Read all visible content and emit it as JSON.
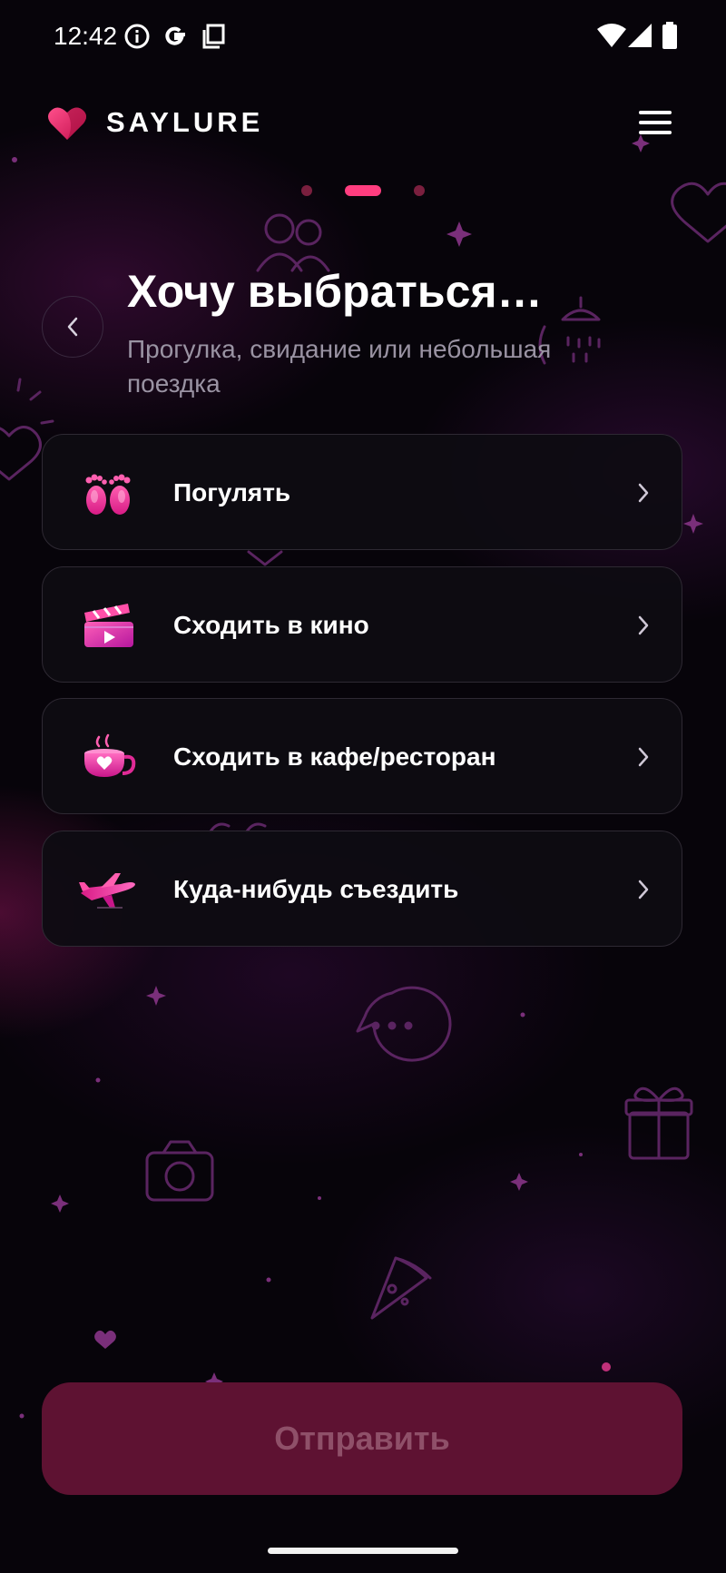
{
  "status_bar": {
    "time": "12:42",
    "icons": [
      "info-icon",
      "google-icon",
      "screenshot-icon",
      "wifi-icon",
      "signal-icon",
      "battery-icon"
    ]
  },
  "header": {
    "brand": "SAYLURE",
    "logo_icon": "heart-logo-icon",
    "menu_icon": "hamburger-menu-icon"
  },
  "pager": {
    "total": 3,
    "active_index": 1
  },
  "page": {
    "title": "Хочу выбраться…",
    "subtitle": "Прогулка, свидание или небольшая поездка"
  },
  "options": [
    {
      "label": "Погулять",
      "icon": "footprints-icon"
    },
    {
      "label": "Сходить в кино",
      "icon": "clapperboard-icon"
    },
    {
      "label": "Сходить в кафе/ресторан",
      "icon": "coffee-cup-icon"
    },
    {
      "label": "Куда-нибудь съездить",
      "icon": "airplane-icon"
    }
  ],
  "submit": {
    "label": "Отправить"
  },
  "colors": {
    "accent": "#ff3d7f",
    "background": "#07040a",
    "card": "#0e0c12",
    "submit_disabled_bg": "#5e1232",
    "submit_disabled_text": "#8f5069"
  }
}
